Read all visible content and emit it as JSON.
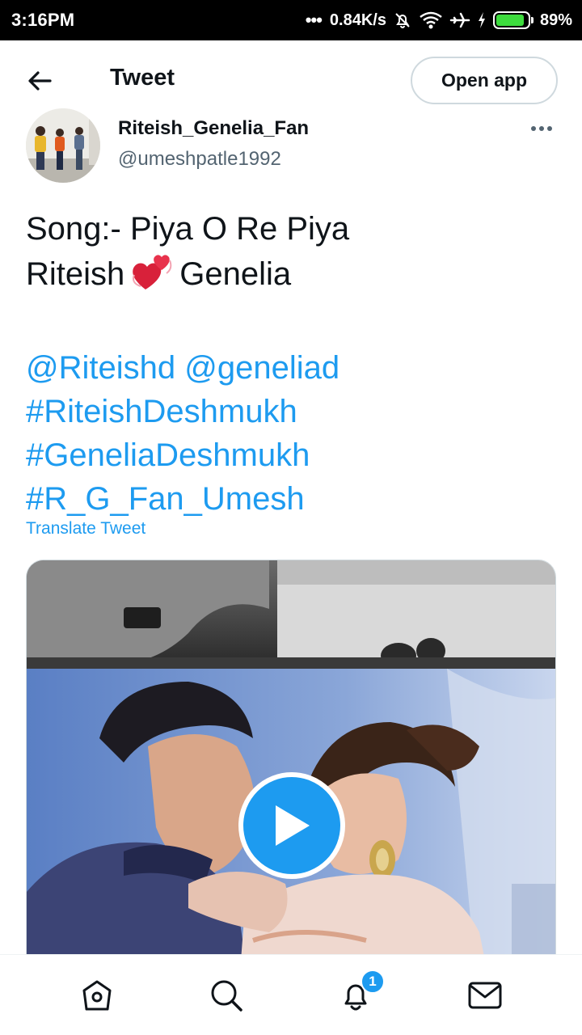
{
  "status_bar": {
    "time": "3:16PM",
    "network_speed": "0.84K/s",
    "battery_percent": "89%",
    "battery_level": 0.89,
    "icons": [
      "dots-icon",
      "silent-bell-icon",
      "wifi-icon",
      "airplane-icon",
      "charging-icon",
      "battery-icon"
    ]
  },
  "header": {
    "title": "Tweet",
    "open_app_label": "Open app",
    "back_icon": "back-arrow-icon"
  },
  "tweet": {
    "author_name": "Riteish_Genelia_Fan",
    "author_handle": "@umeshpatle1992",
    "text_line1": "Song:- Piya O Re Piya",
    "text_line2_a": "Riteish",
    "text_line2_emoji": "revolving-hearts-emoji",
    "text_line2_b": "Genelia",
    "mention1": "@Riteishd",
    "mention2": "@geneliad",
    "hashtag1": "#RiteishDeshmukh",
    "hashtag2": "#GeneliaDeshmukh",
    "hashtag3": "#R_G_Fan_Umesh",
    "translate_label": "Translate Tweet"
  },
  "bottom_nav": {
    "items": [
      "home-icon",
      "search-icon",
      "notifications-icon",
      "messages-icon"
    ],
    "notifications_badge": "1"
  },
  "colors": {
    "link_blue": "#1d9bf0",
    "text_primary": "#0f1419",
    "text_secondary": "#536471",
    "battery_green": "#3ddc3d"
  }
}
